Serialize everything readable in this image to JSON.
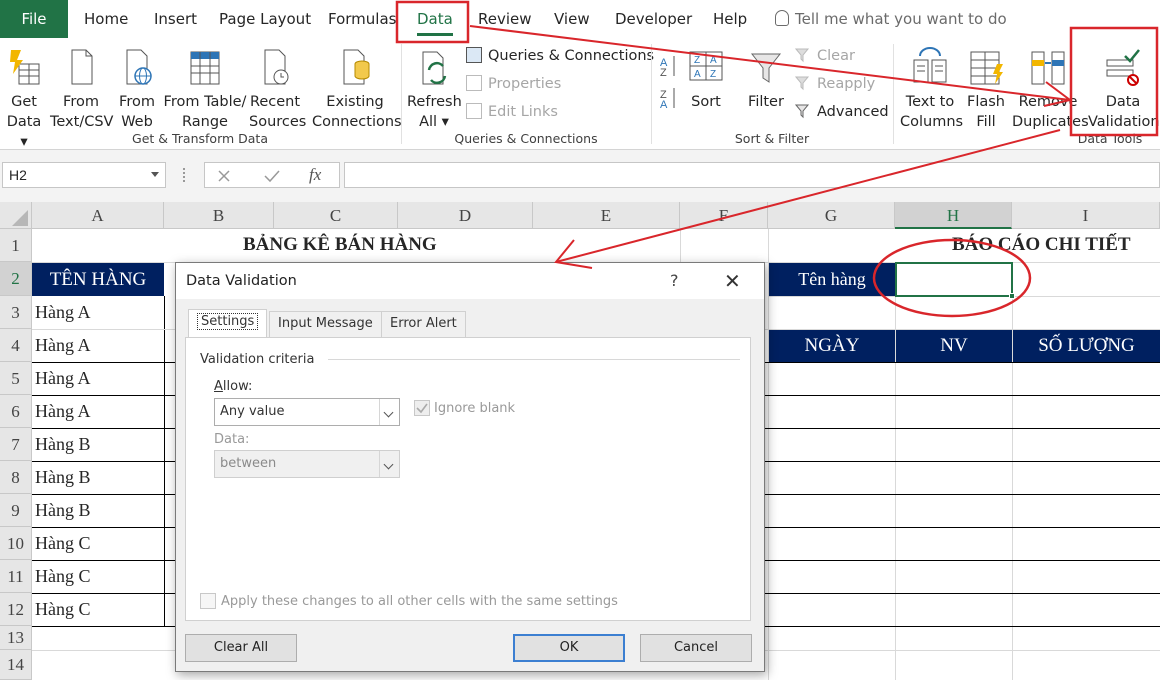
{
  "tabs": {
    "file": "File",
    "home": "Home",
    "insert": "Insert",
    "page_layout": "Page Layout",
    "formulas": "Formulas",
    "data": "Data",
    "review": "Review",
    "view": "View",
    "developer": "Developer",
    "help": "Help",
    "tell_me": "Tell me what you want to do"
  },
  "ribbon": {
    "get_data": [
      "Get",
      "Data ▾"
    ],
    "from_text": [
      "From",
      "Text/CSV"
    ],
    "from_web": [
      "From",
      "Web"
    ],
    "from_table": [
      "From Table/",
      "Range"
    ],
    "recent_sources": [
      "Recent",
      "Sources"
    ],
    "existing_connections": [
      "Existing",
      "Connections"
    ],
    "group_get_transform": "Get & Transform Data",
    "refresh_all": [
      "Refresh",
      "All ▾"
    ],
    "queries_connections": "Queries & Connections",
    "properties": "Properties",
    "edit_links": "Edit Links",
    "group_queries": "Queries & Connections",
    "sort": "Sort",
    "filter": "Filter",
    "clear": "Clear",
    "reapply": "Reapply",
    "advanced": "Advanced",
    "group_sort_filter": "Sort & Filter",
    "text_to_columns": [
      "Text to",
      "Columns"
    ],
    "flash_fill": [
      "Flash",
      "Fill"
    ],
    "remove_duplicates": [
      "Remove",
      "Duplicates"
    ],
    "data_validation": [
      "Data",
      "Validation"
    ],
    "group_data_tools": "Data Tools"
  },
  "formula_bar": {
    "name_box": "H2",
    "fx": "fx",
    "formula": ""
  },
  "sheet": {
    "columns": [
      "A",
      "B",
      "C",
      "D",
      "E",
      "F",
      "G",
      "H",
      "I"
    ],
    "rows": [
      "1",
      "2",
      "3",
      "4",
      "5",
      "6",
      "7",
      "8",
      "9",
      "10",
      "11",
      "12",
      "13",
      "14"
    ],
    "title_left": "BẢNG KÊ BÁN HÀNG",
    "title_right": "BÁO CÁO CHI TIẾT",
    "header_ten_hang": "TÊN HÀNG",
    "label_ten_hang": "Tên hàng",
    "header_ngay": "NGÀY",
    "header_nv": "NV",
    "header_so_luong": "SỐ LƯỢNG",
    "items": [
      "Hàng A",
      "Hàng A",
      "Hàng A",
      "Hàng A",
      "Hàng B",
      "Hàng B",
      "Hàng B",
      "Hàng C",
      "Hàng C",
      "Hàng C"
    ],
    "accent_color": "#002060",
    "annotation_color": "#d9262b"
  },
  "dialog": {
    "title": "Data Validation",
    "help": "?",
    "close": "✕",
    "tab_settings": "Settings",
    "tab_input_message": "Input Message",
    "tab_error_alert": "Error Alert",
    "section": "Validation criteria",
    "allow_label": "Allow:",
    "allow_value": "Any value",
    "ignore_blank": "Ignore blank",
    "data_label": "Data:",
    "data_value": "between",
    "apply_all": "Apply these changes to all other cells with the same settings",
    "clear_all": "Clear All",
    "ok": "OK",
    "cancel": "Cancel"
  }
}
